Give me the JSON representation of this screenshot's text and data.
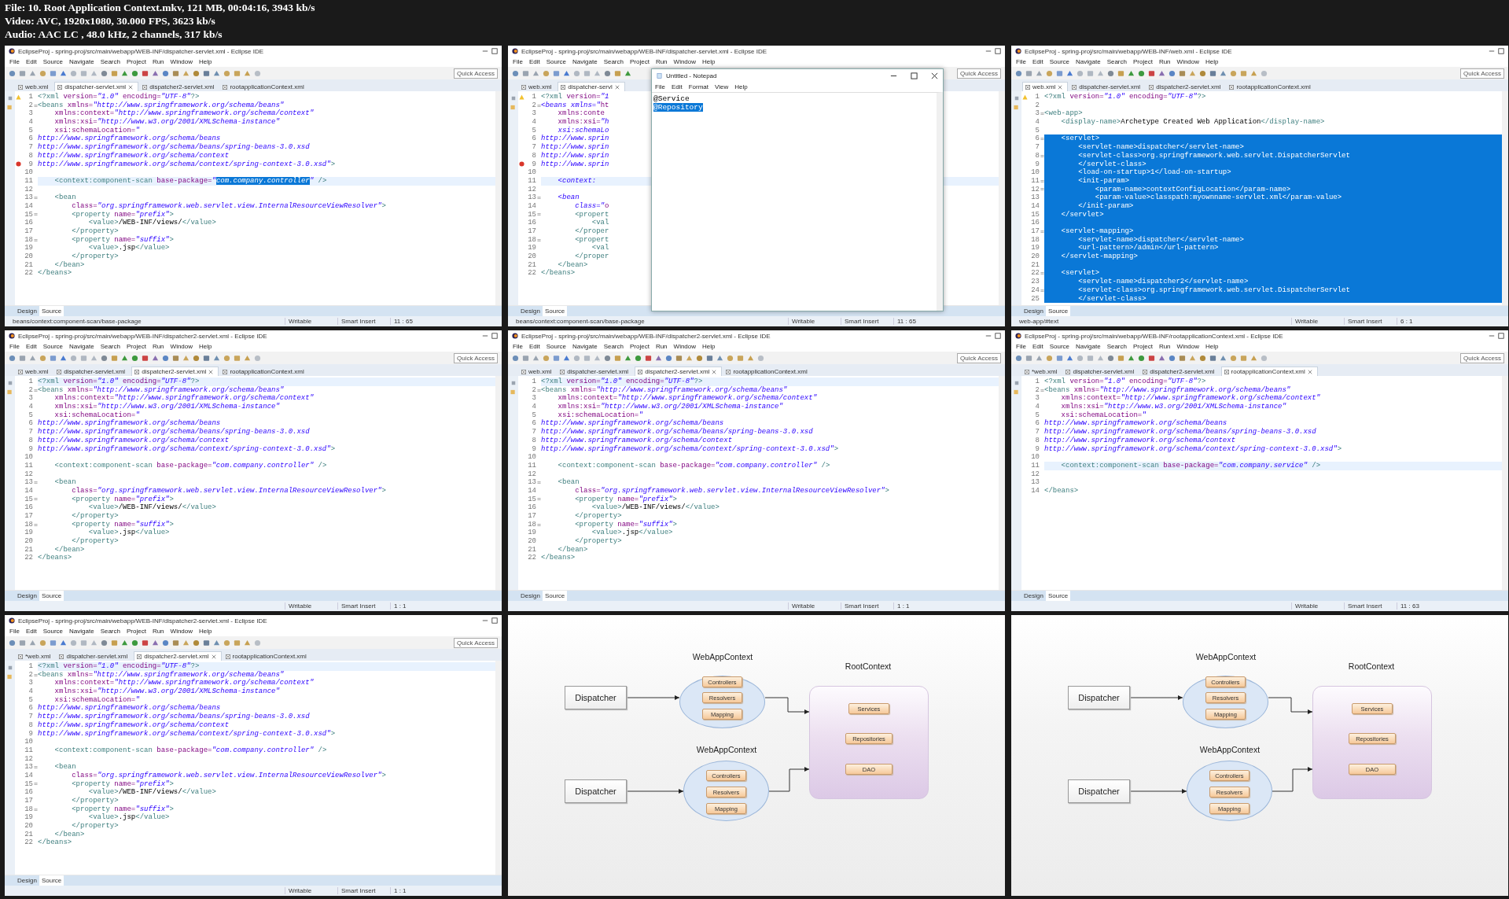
{
  "info": {
    "lines": [
      "File: 10. Root Application Context.mkv, 121 MB, 00:04:16, 3943 kb/s",
      "Video: AVC, 1920x1080, 30.000 FPS, 3623 kb/s",
      "Audio: AAC LC , 48.0 kHz, 2 channels, 317 kb/s"
    ]
  },
  "tiles": [
    {
      "kind": "ide",
      "title": "EclipseProj - spring-proj/src/main/webapp/WEB-INF/dispatcher-servlet.xml - Eclipse IDE",
      "menu": [
        "File",
        "Edit",
        "Source",
        "Navigate",
        "Search",
        "Project",
        "Run",
        "Window",
        "Help"
      ],
      "quick_access": "Quick Access",
      "tabs": [
        {
          "label": "web.xml",
          "selected": false
        },
        {
          "label": "dispatcher-servlet.xml",
          "selected": true
        },
        {
          "label": "dispatcher2-servlet.xml",
          "selected": false
        },
        {
          "label": "rootapplicationContext.xml",
          "selected": false
        }
      ],
      "lines": [
        {
          "n": "1",
          "text": "<?xml version=\"1.0\" encoding=\"UTF-8\"?>",
          "warning": true
        },
        {
          "n": "2",
          "text": "<beans xmlns=\"http://www.springframework.org/schema/beans\"",
          "fold": true
        },
        {
          "n": "3",
          "text": "    xmlns:context=\"http://www.springframework.org/schema/context\""
        },
        {
          "n": "4",
          "text": "    xmlns:xsi=\"http://www.w3.org/2001/XMLSchema-instance\""
        },
        {
          "n": "5",
          "text": "    xsi:schemaLocation=\""
        },
        {
          "n": "6",
          "text": "http://www.springframework.org/schema/beans"
        },
        {
          "n": "7",
          "text": "http://www.springframework.org/schema/beans/spring-beans-3.0.xsd"
        },
        {
          "n": "8",
          "text": "http://www.springframework.org/schema/context"
        },
        {
          "n": "9",
          "text": "http://www.springframework.org/schema/context/spring-context-3.0.xsd\">",
          "error": true
        },
        {
          "n": "10"
        },
        {
          "n": "11",
          "current": true,
          "parts": [
            {
              "text": "    <context:component-scan base-package=\"",
              "selected": false
            },
            {
              "text": "com.company.controller",
              "selected": true
            },
            {
              "text": "\" />",
              "selected": false
            }
          ]
        },
        {
          "n": "12"
        },
        {
          "n": "13",
          "text": "    <bean",
          "fold": true
        },
        {
          "n": "14",
          "text": "        class=\"org.springframework.web.servlet.view.InternalResourceViewResolver\">"
        },
        {
          "n": "15",
          "text": "        <property name=\"prefix\">",
          "fold": true
        },
        {
          "n": "16",
          "text": "            <value>/WEB-INF/views/</value>"
        },
        {
          "n": "17",
          "text": "        </property>"
        },
        {
          "n": "18",
          "text": "        <property name=\"suffix\">",
          "fold": true
        },
        {
          "n": "19",
          "text": "            <value>.jsp</value>"
        },
        {
          "n": "20",
          "text": "        </property>"
        },
        {
          "n": "21",
          "text": "    </bean>"
        },
        {
          "n": "22",
          "text": "</beans>"
        }
      ],
      "editor_tabs": [
        {
          "label": "Design",
          "selected": false
        },
        {
          "label": "Source",
          "selected": true
        }
      ],
      "status": {
        "path": "beans/context:component-scan/base-package",
        "mode": "Writable",
        "insert": "Smart Insert",
        "position": "11 : 65"
      }
    },
    {
      "kind": "ide",
      "title": "EclipseProj - spring-proj/src/main/webapp/WEB-INF/dispatcher-servlet.xml - Eclipse IDE",
      "menu": [
        "File",
        "Edit",
        "Source",
        "Navigate",
        "Search",
        "Project",
        "Run",
        "Window",
        "Help"
      ],
      "quick_access": "Quick Access",
      "tabs": [
        {
          "label": "web.xml",
          "selected": false
        },
        {
          "label": "dispatcher-servl",
          "selected": true
        }
      ],
      "lines": [
        {
          "n": "1",
          "text": "<?xml version=\"1",
          "warning": true
        },
        {
          "n": "2",
          "text": "<beans xmlns=\"ht",
          "fold": true
        },
        {
          "n": "3",
          "text": "    xmlns:conte"
        },
        {
          "n": "4",
          "text": "    xmlns:xsi=\"h"
        },
        {
          "n": "5",
          "text": "    xsi:schemaLo"
        },
        {
          "n": "6",
          "text": "http://www.sprin"
        },
        {
          "n": "7",
          "text": "http://www.sprin"
        },
        {
          "n": "8",
          "text": "http://www.sprin"
        },
        {
          "n": "9",
          "text": "http://www.sprin",
          "error": true
        },
        {
          "n": "10"
        },
        {
          "n": "11",
          "text": "    <context:",
          "current": true
        },
        {
          "n": "12"
        },
        {
          "n": "13",
          "text": "    <bean",
          "fold": true
        },
        {
          "n": "14",
          "text": "        class=\"o"
        },
        {
          "n": "15",
          "text": "        <propert",
          "fold": true
        },
        {
          "n": "16",
          "text": "            <val"
        },
        {
          "n": "17",
          "text": "        </proper"
        },
        {
          "n": "18",
          "text": "        <propert",
          "fold": true
        },
        {
          "n": "19",
          "text": "            <val"
        },
        {
          "n": "20",
          "text": "        </proper"
        },
        {
          "n": "21",
          "text": "    </bean>"
        },
        {
          "n": "22",
          "text": "</beans>"
        }
      ],
      "editor_tabs": [
        {
          "label": "Design",
          "selected": false
        },
        {
          "label": "Source",
          "selected": true
        }
      ],
      "status": {
        "path": "beans/context:component-scan/base-package",
        "mode": "Writable",
        "insert": "Smart Insert",
        "position": "11 : 65"
      },
      "notepad": {
        "title": "Untitled - Notepad",
        "menu": [
          "File",
          "Edit",
          "Format",
          "View",
          "Help"
        ],
        "lines": [
          {
            "text": "@Service",
            "selected": false
          },
          {
            "text": "@Repository",
            "selected": true
          }
        ]
      }
    },
    {
      "kind": "ide",
      "title": "EclipseProj - spring-proj/src/main/webapp/WEB-INF/web.xml - Eclipse IDE",
      "menu": [
        "File",
        "Edit",
        "Source",
        "Navigate",
        "Search",
        "Project",
        "Run",
        "Window",
        "Help"
      ],
      "quick_access": "Quick Access",
      "tabs": [
        {
          "label": "web.xml",
          "selected": true
        },
        {
          "label": "dispatcher-servlet.xml",
          "selected": false
        },
        {
          "label": "dispatcher2-servlet.xml",
          "selected": false
        },
        {
          "label": "rootapplicationContext.xml",
          "selected": false
        }
      ],
      "lines": [
        {
          "n": "1",
          "text": "<?xml version=\"1.0\" encoding=\"UTF-8\"?>",
          "selected": false,
          "warning": true
        },
        {
          "n": "2",
          "selected": false
        },
        {
          "n": "3",
          "text": "<web-app>",
          "selected": false,
          "fold": true
        },
        {
          "n": "4",
          "text": "    <display-name>Archetype Created Web Application</display-name>",
          "selected": false
        },
        {
          "n": "5",
          "selected": false
        },
        {
          "n": "6",
          "text": "    <servlet>",
          "selected": true,
          "fold": true
        },
        {
          "n": "7",
          "text": "        <servlet-name>dispatcher</servlet-name>",
          "selected": true
        },
        {
          "n": "8",
          "text": "        <servlet-class>org.springframework.web.servlet.DispatcherServlet",
          "selected": true,
          "fold": true
        },
        {
          "n": "9",
          "text": "        </servlet-class>",
          "selected": true
        },
        {
          "n": "10",
          "text": "        <load-on-startup>1</load-on-startup>",
          "selected": true
        },
        {
          "n": "11",
          "text": "        <init-param>",
          "selected": true,
          "fold": true
        },
        {
          "n": "12",
          "text": "            <param-name>contextConfigLocation</param-name>",
          "selected": true,
          "fold": true
        },
        {
          "n": "13",
          "text": "            <param-value>classpath:myownname-servlet.xml</param-value>",
          "selected": true
        },
        {
          "n": "14",
          "text": "        </init-param>",
          "selected": true
        },
        {
          "n": "15",
          "text": "    </servlet>",
          "selected": true
        },
        {
          "n": "16",
          "selected": true
        },
        {
          "n": "17",
          "text": "    <servlet-mapping>",
          "selected": true,
          "fold": true
        },
        {
          "n": "18",
          "text": "        <servlet-name>dispatcher</servlet-name>",
          "selected": true
        },
        {
          "n": "19",
          "text": "        <url-pattern>/admin</url-pattern>",
          "selected": true
        },
        {
          "n": "20",
          "text": "    </servlet-mapping>",
          "selected": true
        },
        {
          "n": "21",
          "selected": true
        },
        {
          "n": "22",
          "text": "    <servlet>",
          "selected": true,
          "fold": true
        },
        {
          "n": "23",
          "text": "        <servlet-name>dispatcher2</servlet-name>",
          "selected": true
        },
        {
          "n": "24",
          "text": "        <servlet-class>org.springframework.web.servlet.DispatcherServlet",
          "selected": true,
          "fold": true
        },
        {
          "n": "25",
          "text": "        </servlet-class>",
          "selected": true
        }
      ],
      "editor_tabs": [
        {
          "label": "Design",
          "selected": false
        },
        {
          "label": "Source",
          "selected": true
        }
      ],
      "status": {
        "path": "web-app/#text",
        "mode": "Writable",
        "insert": "Smart Insert",
        "position": "6 : 1"
      }
    },
    {
      "kind": "ide",
      "title": "EclipseProj - spring-proj/src/main/webapp/WEB-INF/dispatcher2-servlet.xml - Eclipse IDE",
      "menu": [
        "File",
        "Edit",
        "Source",
        "Navigate",
        "Search",
        "Project",
        "Run",
        "Window",
        "Help"
      ],
      "quick_access": "Quick Access",
      "tabs": [
        {
          "label": "web.xml",
          "selected": false
        },
        {
          "label": "dispatcher-servlet.xml",
          "selected": false
        },
        {
          "label": "dispatcher2-servlet.xml",
          "selected": true
        },
        {
          "label": "rootapplicationContext.xml",
          "selected": false
        }
      ],
      "lines": [
        {
          "n": "1",
          "text": "<?xml version=\"1.0\" encoding=\"UTF-8\"?>",
          "current": true
        },
        {
          "n": "2",
          "text": "<beans xmlns=\"http://www.springframework.org/schema/beans\"",
          "fold": true
        },
        {
          "n": "3",
          "text": "    xmlns:context=\"http://www.springframework.org/schema/context\""
        },
        {
          "n": "4",
          "text": "    xmlns:xsi=\"http://www.w3.org/2001/XMLSchema-instance\""
        },
        {
          "n": "5",
          "text": "    xsi:schemaLocation=\""
        },
        {
          "n": "6",
          "text": "http://www.springframework.org/schema/beans"
        },
        {
          "n": "7",
          "text": "http://www.springframework.org/schema/beans/spring-beans-3.0.xsd"
        },
        {
          "n": "8",
          "text": "http://www.springframework.org/schema/context"
        },
        {
          "n": "9",
          "text": "http://www.springframework.org/schema/context/spring-context-3.0.xsd\">"
        },
        {
          "n": "10"
        },
        {
          "n": "11",
          "text": "    <context:component-scan base-package=\"com.company.controller\" />"
        },
        {
          "n": "12"
        },
        {
          "n": "13",
          "text": "    <bean",
          "fold": true
        },
        {
          "n": "14",
          "text": "        class=\"org.springframework.web.servlet.view.InternalResourceViewResolver\">"
        },
        {
          "n": "15",
          "text": "        <property name=\"prefix\">",
          "fold": true
        },
        {
          "n": "16",
          "text": "            <value>/WEB-INF/views/</value>"
        },
        {
          "n": "17",
          "text": "        </property>"
        },
        {
          "n": "18",
          "text": "        <property name=\"suffix\">",
          "fold": true
        },
        {
          "n": "19",
          "text": "            <value>.jsp</value>"
        },
        {
          "n": "20",
          "text": "        </property>"
        },
        {
          "n": "21",
          "text": "    </bean>"
        },
        {
          "n": "22",
          "text": "</beans>"
        }
      ],
      "editor_tabs": [
        {
          "label": "Design",
          "selected": false
        },
        {
          "label": "Source",
          "selected": true
        }
      ],
      "status": {
        "mode": "Writable",
        "insert": "Smart Insert",
        "position": "1 : 1"
      }
    },
    {
      "kind": "ide",
      "title": "EclipseProj - spring-proj/src/main/webapp/WEB-INF/dispatcher2-servlet.xml - Eclipse IDE",
      "menu": [
        "File",
        "Edit",
        "Source",
        "Navigate",
        "Search",
        "Project",
        "Run",
        "Window",
        "Help"
      ],
      "quick_access": "Quick Access",
      "tabs": [
        {
          "label": "web.xml",
          "selected": false
        },
        {
          "label": "dispatcher-servlet.xml",
          "selected": false
        },
        {
          "label": "dispatcher2-servlet.xml",
          "selected": true
        },
        {
          "label": "rootapplicationContext.xml",
          "selected": false
        }
      ],
      "lines": [
        {
          "n": "1",
          "text": "<?xml version=\"1.0\" encoding=\"UTF-8\"?>",
          "current": true
        },
        {
          "n": "2",
          "text": "<beans xmlns=\"http://www.springframework.org/schema/beans\"",
          "fold": true
        },
        {
          "n": "3",
          "text": "    xmlns:context=\"http://www.springframework.org/schema/context\""
        },
        {
          "n": "4",
          "text": "    xmlns:xsi=\"http://www.w3.org/2001/XMLSchema-instance\""
        },
        {
          "n": "5",
          "text": "    xsi:schemaLocation=\""
        },
        {
          "n": "6",
          "text": "http://www.springframework.org/schema/beans"
        },
        {
          "n": "7",
          "text": "http://www.springframework.org/schema/beans/spring-beans-3.0.xsd"
        },
        {
          "n": "8",
          "text": "http://www.springframework.org/schema/context"
        },
        {
          "n": "9",
          "text": "http://www.springframework.org/schema/context/spring-context-3.0.xsd\">"
        },
        {
          "n": "10"
        },
        {
          "n": "11",
          "text": "    <context:component-scan base-package=\"com.company.controller\" />"
        },
        {
          "n": "12"
        },
        {
          "n": "13",
          "text": "    <bean",
          "fold": true
        },
        {
          "n": "14",
          "text": "        class=\"org.springframework.web.servlet.view.InternalResourceViewResolver\">"
        },
        {
          "n": "15",
          "text": "        <property name=\"prefix\">",
          "fold": true
        },
        {
          "n": "16",
          "text": "            <value>/WEB-INF/views/</value>"
        },
        {
          "n": "17",
          "text": "        </property>"
        },
        {
          "n": "18",
          "text": "        <property name=\"suffix\">",
          "fold": true
        },
        {
          "n": "19",
          "text": "            <value>.jsp</value>"
        },
        {
          "n": "20",
          "text": "        </property>"
        },
        {
          "n": "21",
          "text": "    </bean>"
        },
        {
          "n": "22",
          "text": "</beans>"
        }
      ],
      "editor_tabs": [
        {
          "label": "Design",
          "selected": false
        },
        {
          "label": "Source",
          "selected": true
        }
      ],
      "status": {
        "mode": "Writable",
        "insert": "Smart Insert",
        "position": "1 : 1"
      }
    },
    {
      "kind": "ide",
      "title": "EclipseProj - spring-proj/src/main/webapp/WEB-INF/rootapplicationContext.xml - Eclipse IDE",
      "menu": [
        "File",
        "Edit",
        "Source",
        "Navigate",
        "Search",
        "Project",
        "Run",
        "Window",
        "Help"
      ],
      "quick_access": "Quick Access",
      "tabs": [
        {
          "label": "*web.xml",
          "selected": false
        },
        {
          "label": "dispatcher-servlet.xml",
          "selected": false
        },
        {
          "label": "dispatcher2-servlet.xml",
          "selected": false
        },
        {
          "label": "rootapplicationContext.xml",
          "selected": true
        }
      ],
      "lines": [
        {
          "n": "1",
          "text": "<?xml version=\"1.0\" encoding=\"UTF-8\"?>"
        },
        {
          "n": "2",
          "text": "<beans xmlns=\"http://www.springframework.org/schema/beans\"",
          "fold": true
        },
        {
          "n": "3",
          "text": "    xmlns:context=\"http://www.springframework.org/schema/context\""
        },
        {
          "n": "4",
          "text": "    xmlns:xsi=\"http://www.w3.org/2001/XMLSchema-instance\""
        },
        {
          "n": "5",
          "text": "    xsi:schemaLocation=\""
        },
        {
          "n": "6",
          "text": "http://www.springframework.org/schema/beans"
        },
        {
          "n": "7",
          "text": "http://www.springframework.org/schema/beans/spring-beans-3.0.xsd"
        },
        {
          "n": "8",
          "text": "http://www.springframework.org/schema/context"
        },
        {
          "n": "9",
          "text": "http://www.springframework.org/schema/context/spring-context-3.0.xsd\">"
        },
        {
          "n": "10"
        },
        {
          "n": "11",
          "text": "    <context:component-scan base-package=\"com.company.service\" />",
          "current": true
        },
        {
          "n": "12"
        },
        {
          "n": "13"
        },
        {
          "n": "14",
          "text": "</beans>"
        }
      ],
      "editor_tabs": [
        {
          "label": "Design",
          "selected": false
        },
        {
          "label": "Source",
          "selected": true
        }
      ],
      "status": {
        "mode": "Writable",
        "insert": "Smart Insert",
        "position": "11 : 63"
      }
    },
    {
      "kind": "ide",
      "title": "EclipseProj - spring-proj/src/main/webapp/WEB-INF/dispatcher2-servlet.xml - Eclipse IDE",
      "menu": [
        "File",
        "Edit",
        "Source",
        "Navigate",
        "Search",
        "Project",
        "Run",
        "Window",
        "Help"
      ],
      "quick_access": "Quick Access",
      "tabs": [
        {
          "label": "*web.xml",
          "selected": false
        },
        {
          "label": "dispatcher-servlet.xml",
          "selected": false
        },
        {
          "label": "dispatcher2-servlet.xml",
          "selected": true
        },
        {
          "label": "rootapplicationContext.xml",
          "selected": false
        }
      ],
      "lines": [
        {
          "n": "1",
          "text": "<?xml version=\"1.0\" encoding=\"UTF-8\"?>",
          "current": true
        },
        {
          "n": "2",
          "text": "<beans xmlns=\"http://www.springframework.org/schema/beans\"",
          "fold": true
        },
        {
          "n": "3",
          "text": "    xmlns:context=\"http://www.springframework.org/schema/context\""
        },
        {
          "n": "4",
          "text": "    xmlns:xsi=\"http://www.w3.org/2001/XMLSchema-instance\""
        },
        {
          "n": "5",
          "text": "    xsi:schemaLocation=\""
        },
        {
          "n": "6",
          "text": "http://www.springframework.org/schema/beans"
        },
        {
          "n": "7",
          "text": "http://www.springframework.org/schema/beans/spring-beans-3.0.xsd"
        },
        {
          "n": "8",
          "text": "http://www.springframework.org/schema/context"
        },
        {
          "n": "9",
          "text": "http://www.springframework.org/schema/context/spring-context-3.0.xsd\">"
        },
        {
          "n": "10"
        },
        {
          "n": "11",
          "text": "    <context:component-scan base-package=\"com.company.controller\" />"
        },
        {
          "n": "12"
        },
        {
          "n": "13",
          "text": "    <bean",
          "fold": true
        },
        {
          "n": "14",
          "text": "        class=\"org.springframework.web.servlet.view.InternalResourceViewResolver\">"
        },
        {
          "n": "15",
          "text": "        <property name=\"prefix\">",
          "fold": true
        },
        {
          "n": "16",
          "text": "            <value>/WEB-INF/views/</value>"
        },
        {
          "n": "17",
          "text": "        </property>"
        },
        {
          "n": "18",
          "text": "        <property name=\"suffix\">",
          "fold": true
        },
        {
          "n": "19",
          "text": "            <value>.jsp</value>"
        },
        {
          "n": "20",
          "text": "        </property>"
        },
        {
          "n": "21",
          "text": "    </bean>"
        },
        {
          "n": "22",
          "text": "</beans>"
        }
      ],
      "editor_tabs": [
        {
          "label": "Design",
          "selected": false
        },
        {
          "label": "Source",
          "selected": true
        }
      ],
      "status": {
        "mode": "Writable",
        "insert": "Smart Insert",
        "position": "1 : 1"
      }
    },
    {
      "kind": "diagram",
      "dispatchers": [
        "Dispatcher",
        "Dispatcher"
      ],
      "contexts": [
        {
          "title": "WebAppContext",
          "items": [
            "Controllers",
            "Resolvers",
            "Mapping"
          ]
        },
        {
          "title": "WebAppContext",
          "items": [
            "Controllers",
            "Resolvers",
            "Mapping"
          ]
        }
      ],
      "root": {
        "title": "RootContext",
        "items": [
          "Services",
          "Repositories",
          "DAO"
        ]
      }
    },
    {
      "kind": "diagram",
      "dispatchers": [
        "Dispatcher",
        "Dispatcher"
      ],
      "contexts": [
        {
          "title": "WebAppContext",
          "items": [
            "Controllers",
            "Resolvers",
            "Mapping"
          ]
        },
        {
          "title": "WebAppContext",
          "items": [
            "Controllers",
            "Resolvers",
            "Mapping"
          ]
        }
      ],
      "root": {
        "title": "RootContext",
        "items": [
          "Services",
          "Repositories",
          "DAO"
        ]
      }
    }
  ]
}
